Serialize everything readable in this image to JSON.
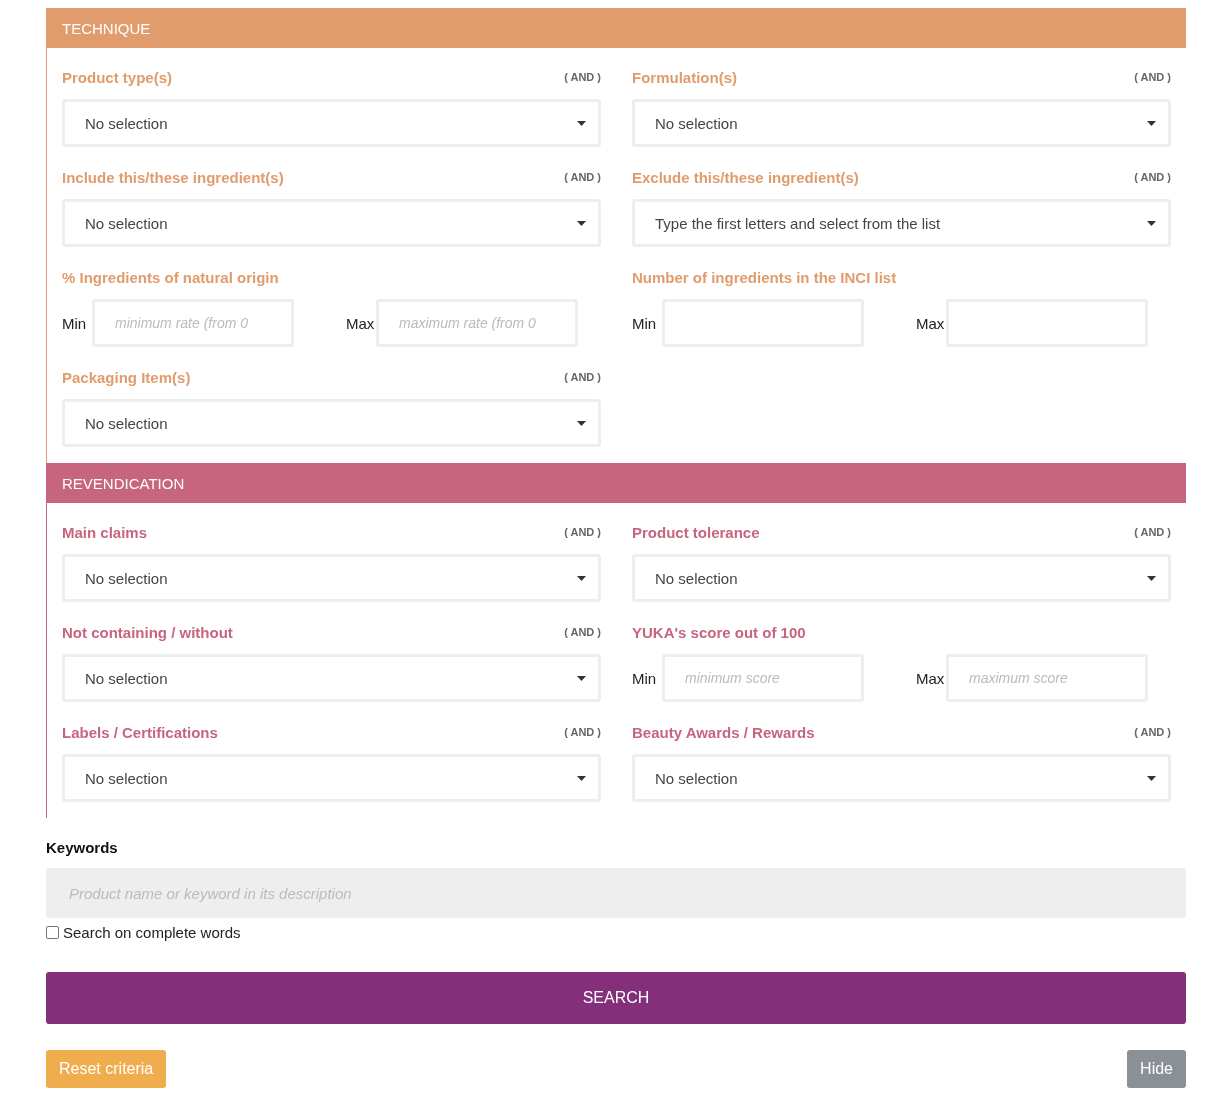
{
  "sections": [
    {
      "title": "TECHNIQUE",
      "color": "#e09c6c",
      "fields": [
        {
          "kind": "select",
          "label": "Product type(s)",
          "operator": "( AND )",
          "placeholder": "No selection"
        },
        {
          "kind": "select",
          "label": "Formulation(s)",
          "operator": "( AND )",
          "placeholder": "No selection"
        },
        {
          "kind": "select",
          "label": "Include this/these ingredient(s)",
          "operator": "( AND )",
          "placeholder": "No selection"
        },
        {
          "kind": "select",
          "label": "Exclude this/these ingredient(s)",
          "operator": "( AND )",
          "placeholder": "Type the first letters and select from the list"
        },
        {
          "kind": "range",
          "label": "% Ingredients of natural origin",
          "min_label": "Min",
          "min_placeholder": "minimum rate (from 0",
          "max_label": "Max",
          "max_placeholder": "maximum rate (from 0"
        },
        {
          "kind": "range",
          "label": "Number of ingredients in the INCI list",
          "min_label": "Min",
          "max_label": "Max"
        },
        {
          "kind": "select",
          "label": "Packaging Item(s)",
          "operator": "( AND )",
          "placeholder": "No selection"
        }
      ]
    },
    {
      "title": "REVENDICATION",
      "color": "#c7657f",
      "fields": [
        {
          "kind": "select",
          "label": "Main claims",
          "operator": "( AND )",
          "placeholder": "No selection"
        },
        {
          "kind": "select",
          "label": "Product tolerance",
          "operator": "( AND )",
          "placeholder": "No selection"
        },
        {
          "kind": "select",
          "label": "Not containing / without",
          "operator": "( AND )",
          "placeholder": "No selection"
        },
        {
          "kind": "range",
          "label": "YUKA's score out of 100",
          "min_label": "Min",
          "min_placeholder": "minimum score",
          "max_label": "Max",
          "max_placeholder": "maximum score"
        },
        {
          "kind": "select",
          "label": "Labels / Certifications",
          "operator": "( AND )",
          "placeholder": "No selection"
        },
        {
          "kind": "select",
          "label": "Beauty Awards / Rewards",
          "operator": "( AND )",
          "placeholder": "No selection"
        }
      ]
    }
  ],
  "keywords": {
    "label": "Keywords",
    "placeholder": "Product name or keyword in its description"
  },
  "complete_words": {
    "label": "Search on complete words",
    "checked": false
  },
  "search_button": "SEARCH",
  "reset_button": "Reset criteria",
  "hide_button": "Hide"
}
